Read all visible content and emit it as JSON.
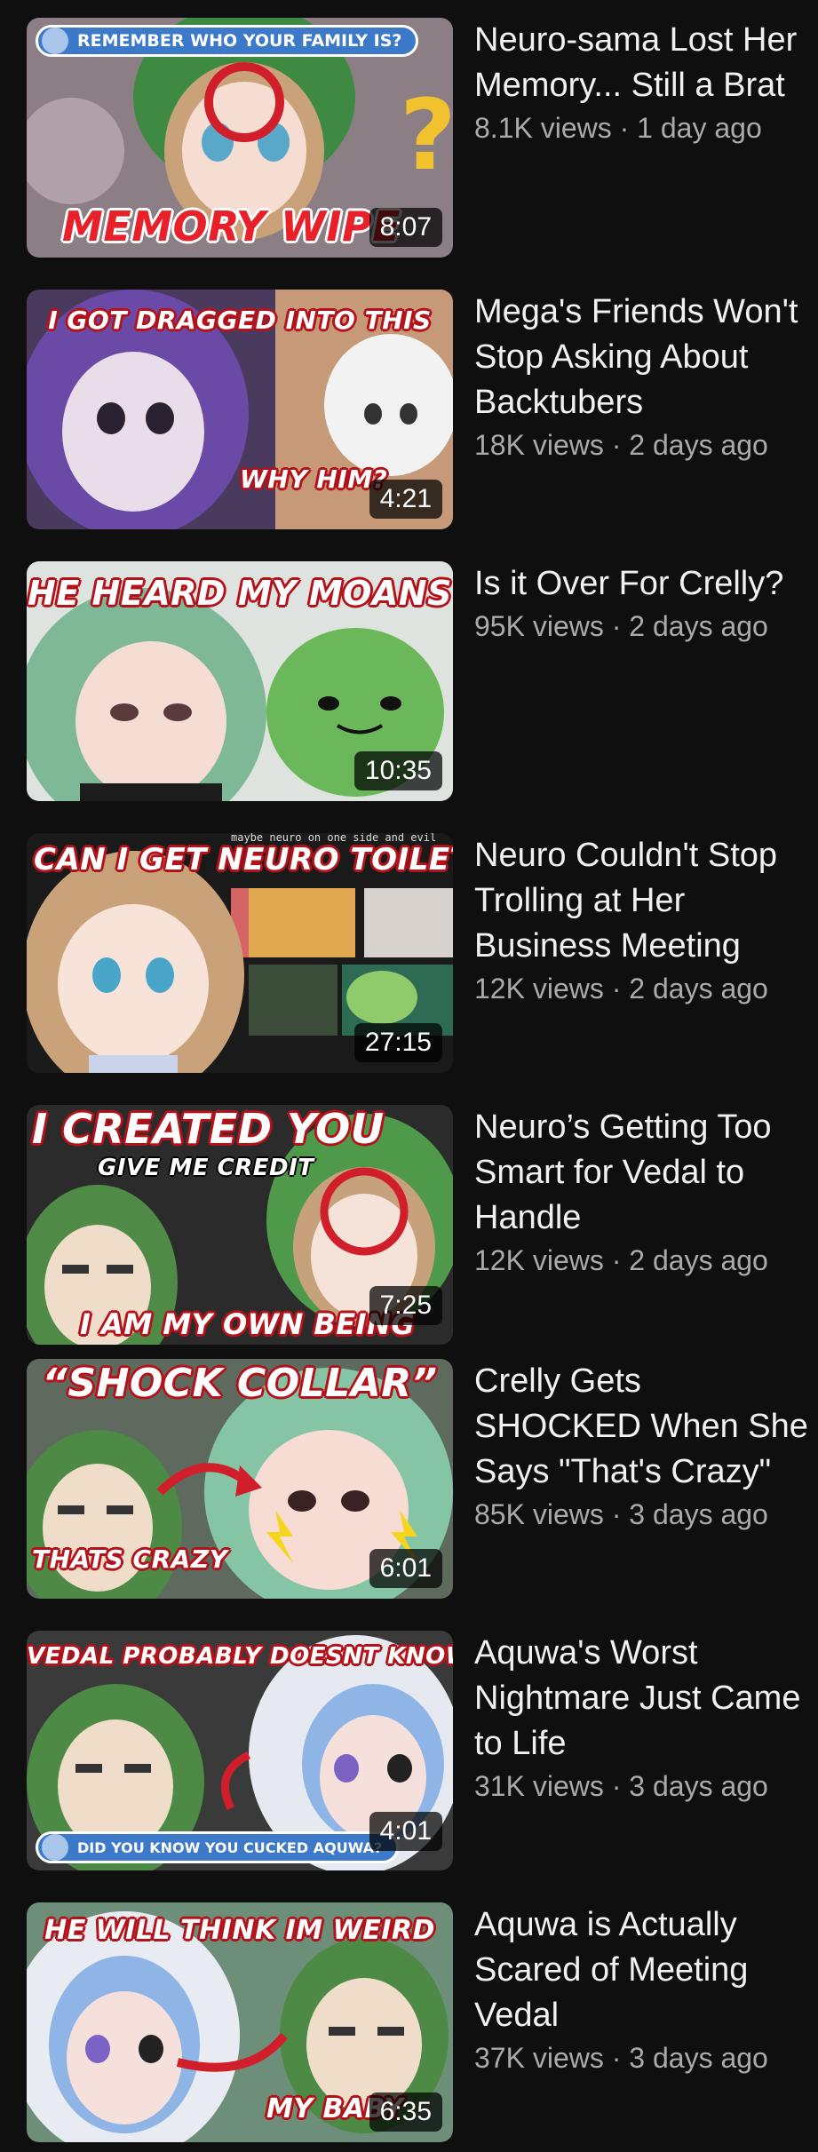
{
  "videos": [
    {
      "title": "Neuro-sama Lost Her Memory... Still a Brat",
      "views": "8.1K views",
      "age": "1 day ago",
      "duration": "8:07",
      "thumb_top_pill": "REMEMBER WHO YOUR FAMILY IS?",
      "thumb_bottom": "MEMORY WIPE"
    },
    {
      "title": "Mega's Friends Won't Stop Asking About Backtubers",
      "views": "18K views",
      "age": "2 days ago",
      "duration": "4:21",
      "thumb_top": "I GOT DRAGGED INTO THIS",
      "thumb_bottom": "WHY HIM?"
    },
    {
      "title": "Is it Over For Crelly?",
      "views": "95K views",
      "age": "2 days ago",
      "duration": "10:35",
      "thumb_top": "HE HEARD MY MOANS"
    },
    {
      "title": "Neuro Couldn't Stop Trolling at Her Business Meeting",
      "views": "12K views",
      "age": "2 days ago",
      "duration": "27:15",
      "thumb_top": "CAN I GET NEURO TOILET?",
      "thumb_note": "maybe neuro on one side and evil"
    },
    {
      "title": "Neuro’s Getting Too Smart for Vedal to Handle",
      "views": "12K views",
      "age": "2 days ago",
      "duration": "7:25",
      "thumb_top": "I CREATED YOU",
      "thumb_sub": "GIVE ME CREDIT",
      "thumb_bottom": "I AM MY OWN BEING"
    },
    {
      "title": "Crelly Gets SHOCKED When She Says \"That's Crazy\"",
      "views": "85K views",
      "age": "3 days ago",
      "duration": "6:01",
      "thumb_top": "“SHOCK COLLAR”",
      "thumb_bottom": "THATS CRAZY"
    },
    {
      "title": "Aquwa's Worst Nightmare Just Came to Life",
      "views": "31K views",
      "age": "3 days ago",
      "duration": "4:01",
      "thumb_top": "VEDAL PROBABLY DOESNT KNOW",
      "thumb_bottom_pill": "DID YOU KNOW YOU CUCKED AQUWA?"
    },
    {
      "title": "Aquwa is Actually Scared of Meeting Vedal",
      "views": "37K views",
      "age": "3 days ago",
      "duration": "6:35",
      "thumb_top": "HE WILL THINK IM WEIRD",
      "thumb_bottom": "MY BABY"
    }
  ],
  "separator": " · "
}
